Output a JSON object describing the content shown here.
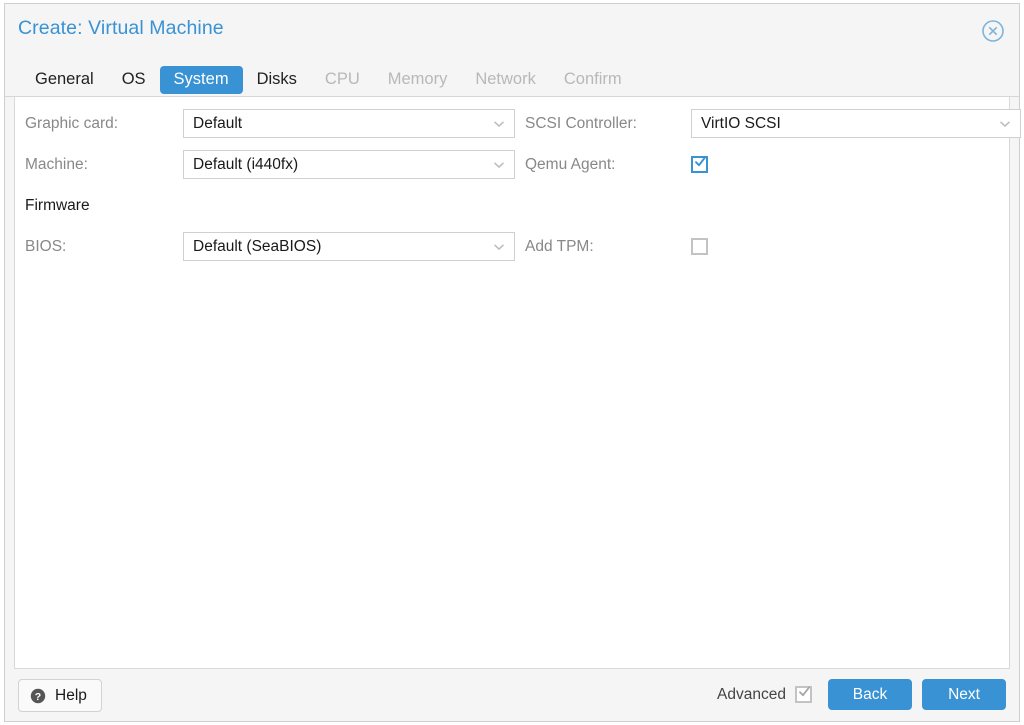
{
  "window": {
    "title": "Create: Virtual Machine",
    "close_icon": "close-circle-icon"
  },
  "tabs": [
    {
      "label": "General",
      "state": "enabled"
    },
    {
      "label": "OS",
      "state": "enabled"
    },
    {
      "label": "System",
      "state": "active"
    },
    {
      "label": "Disks",
      "state": "enabled"
    },
    {
      "label": "CPU",
      "state": "disabled"
    },
    {
      "label": "Memory",
      "state": "disabled"
    },
    {
      "label": "Network",
      "state": "disabled"
    },
    {
      "label": "Confirm",
      "state": "disabled"
    }
  ],
  "form": {
    "left": {
      "graphic_card": {
        "label": "Graphic card:",
        "value": "Default"
      },
      "machine": {
        "label": "Machine:",
        "value": "Default (i440fx)"
      },
      "firmware_heading": "Firmware",
      "bios": {
        "label": "BIOS:",
        "value": "Default (SeaBIOS)"
      }
    },
    "right": {
      "scsi_controller": {
        "label": "SCSI Controller:",
        "value": "VirtIO SCSI"
      },
      "qemu_agent": {
        "label": "Qemu Agent:",
        "checked": true
      },
      "add_tpm": {
        "label": "Add TPM:",
        "checked": false
      }
    }
  },
  "footer": {
    "help_label": "Help",
    "help_icon": "question-circle-icon",
    "advanced_label": "Advanced",
    "advanced_checked": true,
    "back_label": "Back",
    "next_label": "Next"
  },
  "colors": {
    "accent": "#3892d4",
    "title_text": "#3892d4",
    "label_text": "#888888",
    "disabled_tab": "#b8b8b8",
    "checkbox_gray": "#c3c3c3",
    "panel_bg": "#ffffff",
    "chrome_bg": "#f5f5f5"
  }
}
